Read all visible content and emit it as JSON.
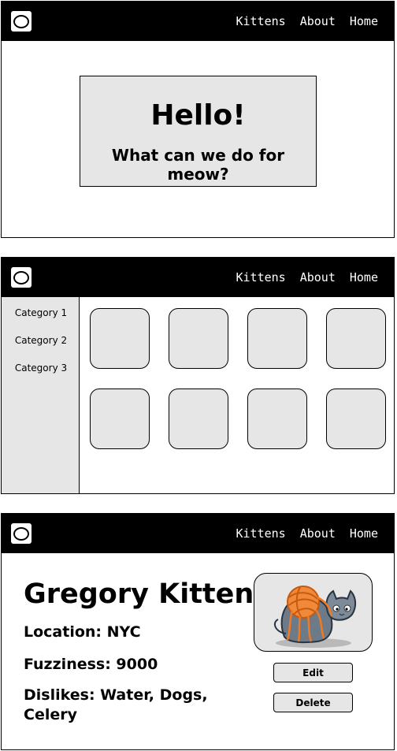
{
  "nav": {
    "links": [
      "Kittens",
      "About",
      "Home"
    ]
  },
  "home": {
    "title": "Hello!",
    "subtitle": "What can we do for meow?"
  },
  "listing": {
    "categories": [
      "Category 1",
      "Category 2",
      "Category 3"
    ]
  },
  "detail": {
    "name": "Gregory Kitten",
    "location": "Location: NYC",
    "fuzziness": "Fuzziness: 9000",
    "dislikes": "Dislikes: Water, Dogs, Celery",
    "edit_label": "Edit",
    "delete_label": "Delete",
    "image_icon": "kitten-with-yarn-icon"
  },
  "colors": {
    "navbar": "#000000",
    "panel": "#e6e6e6",
    "yarn": "#f07a24",
    "cat": "#6d7a88"
  }
}
